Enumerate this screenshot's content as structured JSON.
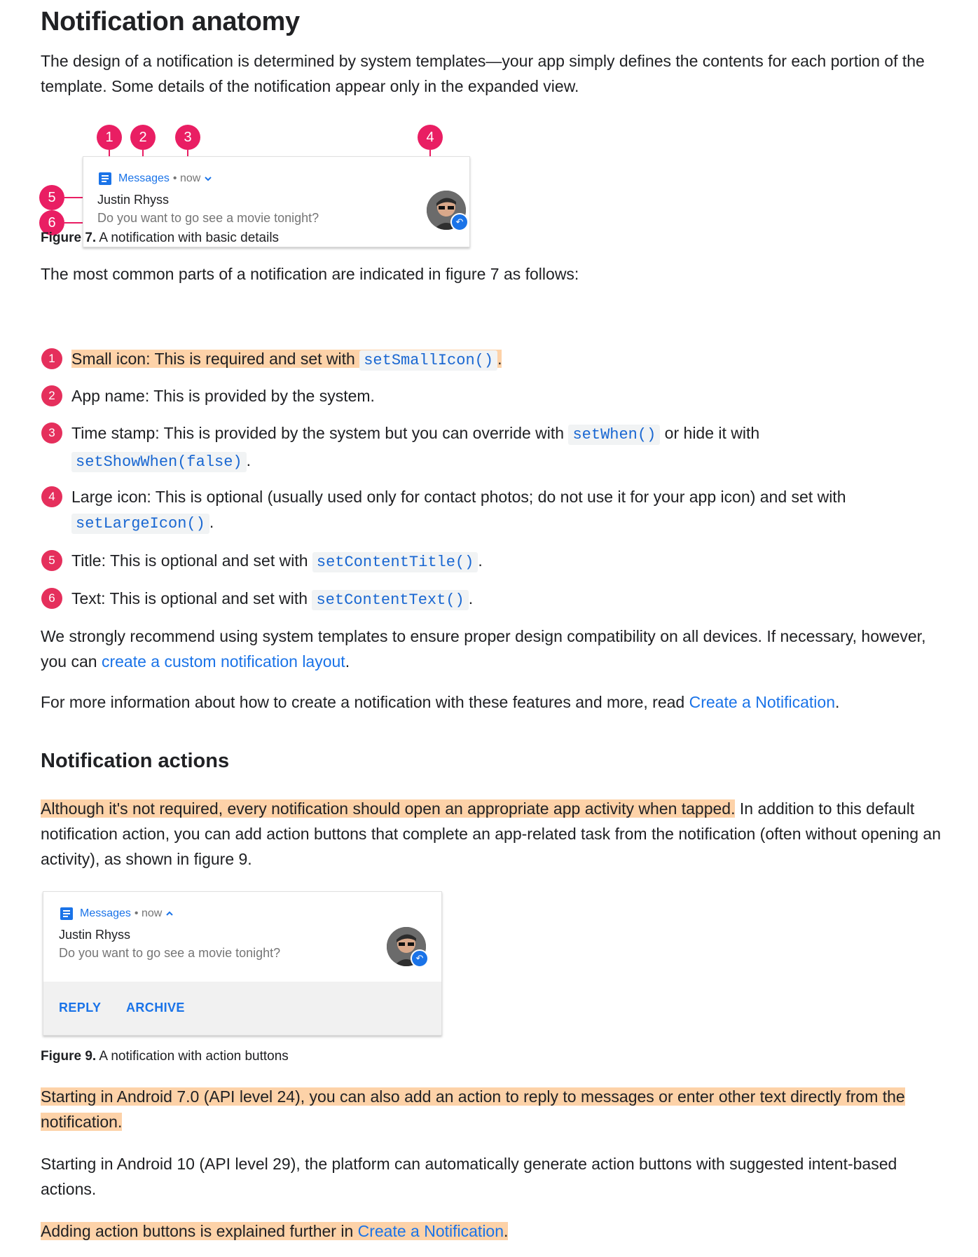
{
  "heading": "Notification anatomy",
  "intro": "The design of a notification is determined by system templates—your app simply defines the contents for each portion of the template. Some details of the notification appear only in the expanded view.",
  "figure7": {
    "app_name": "Messages",
    "time": "• now",
    "title": "Justin Rhyss",
    "text": "Do you want to go see a movie tonight?",
    "callouts": [
      "1",
      "2",
      "3",
      "4",
      "5",
      "6"
    ],
    "caption_label": "Figure 7.",
    "caption_text": " A notification with basic details"
  },
  "list_intro": "The most common parts of a notification are indicated in figure 7 as follows:",
  "items": [
    {
      "num": "1",
      "text": "Small icon: This is required and set with ",
      "code": "setSmallIcon()",
      "after": "."
    },
    {
      "num": "2",
      "text": "App name: This is provided by the system."
    },
    {
      "num": "3",
      "text": "Time stamp: This is provided by the system but you can override with ",
      "code": "setWhen()",
      "mid": " or hide it with",
      "code2": "setShowWhen(false)",
      "after": "."
    },
    {
      "num": "4",
      "text": "Large icon: This is optional (usually used only for contact photos; do not use it for your app icon) and set with",
      "code": "setLargeIcon()",
      "after": "."
    },
    {
      "num": "5",
      "text": "Title: This is optional and set with ",
      "code": "setContentTitle()",
      "after": "."
    },
    {
      "num": "6",
      "text": "Text: This is optional and set with ",
      "code": "setContentText()",
      "after": "."
    }
  ],
  "recommend": {
    "before": "We strongly recommend using system templates to ensure proper design compatibility on all devices. If necessary, however, you can ",
    "link": "create a custom notification layout",
    "after": "."
  },
  "more_info": {
    "before": "For more information about how to create a notification with these features and more, read ",
    "link": "Create a Notification",
    "after": "."
  },
  "section2_heading": "Notification actions",
  "actions_para": {
    "highlight": "Although it's not required, every notification should open an appropriate app activity when tapped.",
    "rest": " In addition to this default notification action, you can add action buttons that complete an app-related task from the notification (often without opening an activity), as shown in figure 9."
  },
  "figure9": {
    "app_name": "Messages",
    "time": "• now",
    "title": "Justin Rhyss",
    "text": "Do you want to go see a movie tonight?",
    "reply": "REPLY",
    "archive": "ARCHIVE",
    "caption_label": "Figure 9.",
    "caption_text": " A notification with action buttons"
  },
  "android7_para": "Starting in Android 7.0 (API level 24), you can also add an action to reply to messages or enter other text directly from the notification.",
  "android10_para": "Starting in Android 10 (API level 29), the platform can automatically generate action buttons with suggested intent-based actions.",
  "final_para": {
    "before": "Adding action buttons is explained further in ",
    "link": "Create a Notification",
    "after": "."
  },
  "colors": {
    "accent": "#e91e63",
    "link": "#1a73e8",
    "highlight": "#fdd2a8"
  },
  "icons": [
    "messages-icon",
    "chevron-down-icon",
    "chevron-up-icon",
    "reply-icon",
    "avatar"
  ]
}
